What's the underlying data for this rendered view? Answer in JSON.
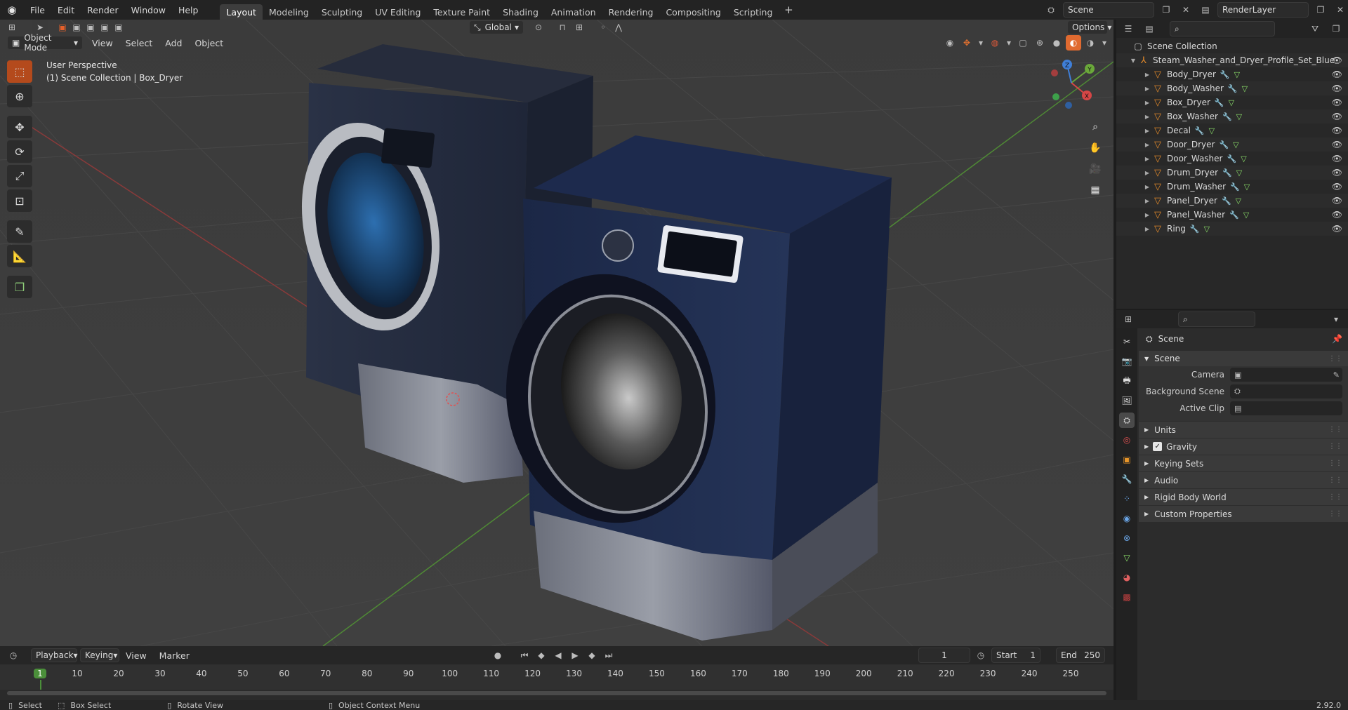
{
  "topbar": {
    "menus": [
      "File",
      "Edit",
      "Render",
      "Window",
      "Help"
    ],
    "workspaces": [
      "Layout",
      "Modeling",
      "Sculpting",
      "UV Editing",
      "Texture Paint",
      "Shading",
      "Animation",
      "Rendering",
      "Compositing",
      "Scripting"
    ],
    "active_workspace": "Layout",
    "scene_name": "Scene",
    "view_layer": "RenderLayer"
  },
  "viewport": {
    "mode": "Object Mode",
    "menus": [
      "View",
      "Select",
      "Add",
      "Object"
    ],
    "transform_orientation": "Global",
    "options_label": "Options",
    "overlay_line1": "User Perspective",
    "overlay_line2": "(1) Scene Collection | Box_Dryer",
    "gizmo_axes": {
      "x": "X",
      "y": "Y",
      "z": "Z"
    }
  },
  "outliner": {
    "root": "Scene Collection",
    "collection": "Steam_Washer_and_Dryer_Profile_Set_Blue",
    "objects": [
      "Body_Dryer",
      "Body_Washer",
      "Box_Dryer",
      "Box_Washer",
      "Decal",
      "Door_Dryer",
      "Door_Washer",
      "Drum_Dryer",
      "Drum_Washer",
      "Panel_Dryer",
      "Panel_Washer",
      "Ring"
    ]
  },
  "properties": {
    "breadcrumb": "Scene",
    "panel_title": "Scene",
    "rows": [
      {
        "label": "Camera"
      },
      {
        "label": "Background Scene"
      },
      {
        "label": "Active Clip"
      }
    ],
    "subpanels": [
      "Units",
      "Gravity",
      "Keying Sets",
      "Audio",
      "Rigid Body World",
      "Custom Properties"
    ],
    "gravity_checked": true
  },
  "timeline": {
    "menus": [
      "Playback",
      "Keying",
      "View",
      "Marker"
    ],
    "current_frame": "1",
    "start_label": "Start",
    "start": "1",
    "end_label": "End",
    "end": "250",
    "ticks": [
      "1",
      "10",
      "20",
      "30",
      "40",
      "50",
      "60",
      "70",
      "80",
      "90",
      "100",
      "110",
      "120",
      "130",
      "140",
      "150",
      "160",
      "170",
      "180",
      "190",
      "200",
      "210",
      "220",
      "230",
      "240",
      "250"
    ]
  },
  "statusbar": {
    "select": "Select",
    "box_select": "Box Select",
    "rotate_view": "Rotate View",
    "context_menu": "Object Context Menu",
    "version": "2.92.0"
  },
  "colors": {
    "accent": "#e48a2a",
    "active_tool": "#b44a1c",
    "viewport_bg": "#3d3d3d"
  }
}
